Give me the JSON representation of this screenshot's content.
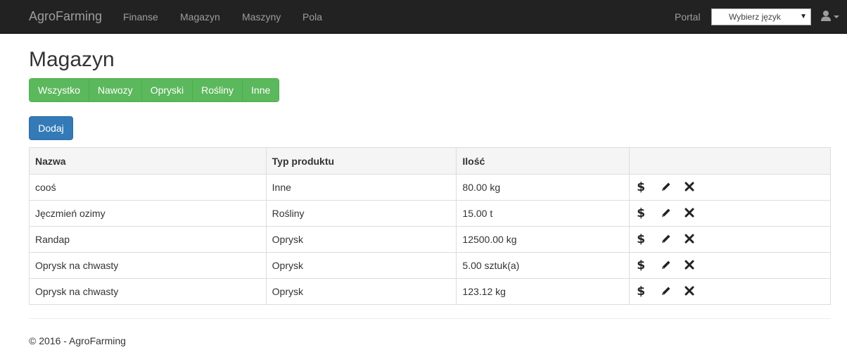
{
  "navbar": {
    "brand": "AgroFarming",
    "links": [
      "Finanse",
      "Magazyn",
      "Maszyny",
      "Pola"
    ],
    "portal": "Portal",
    "language_select": "Wybierz język"
  },
  "page": {
    "title": "Magazyn",
    "filters": [
      "Wszystko",
      "Nawozy",
      "Opryski",
      "Rośliny",
      "Inne"
    ],
    "add_label": "Dodaj"
  },
  "table": {
    "headers": [
      "Nazwa",
      "Typ produktu",
      "Ilość",
      ""
    ],
    "rows": [
      {
        "name": "cooś",
        "type": "Inne",
        "qty": "80.00 kg"
      },
      {
        "name": "Jęczmień ozimy",
        "type": "Rośliny",
        "qty": "15.00 t"
      },
      {
        "name": "Randap",
        "type": "Oprysk",
        "qty": "12500.00 kg"
      },
      {
        "name": "Oprysk na chwasty",
        "type": "Oprysk",
        "qty": "5.00 sztuk(a)"
      },
      {
        "name": "Oprysk na chwasty",
        "type": "Oprysk",
        "qty": "123.12 kg"
      }
    ],
    "action_dollar": "$",
    "action_icons": [
      "dollar-icon",
      "pencil-icon",
      "remove-icon"
    ]
  },
  "footer": {
    "text": "© 2016 - AgroFarming"
  },
  "colors": {
    "navbar_bg": "#222222",
    "filter_green": "#5cb85c",
    "primary_blue": "#337ab7"
  }
}
